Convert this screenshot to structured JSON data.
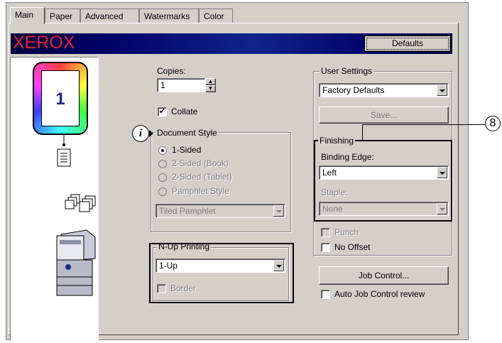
{
  "tabs": [
    "Main",
    "Paper",
    "Advanced",
    "Watermarks",
    "Color"
  ],
  "banner": {
    "brand": "XEROX",
    "defaults_label": "Defaults"
  },
  "preview": {
    "page_number": "1"
  },
  "copies": {
    "label": "Copies:",
    "value": "1"
  },
  "collate": {
    "label": "Collate",
    "checked": true
  },
  "document_style": {
    "label": "Document Style",
    "options": [
      "1-Sided",
      "2-Sided (Book)",
      "2-Sided (Tablet)",
      "Pamphlet Style"
    ],
    "selected": "1-Sided",
    "pamphlet_select": "Tiled Pamphlet"
  },
  "nup": {
    "label": "N-Up Printing",
    "value": "1-Up",
    "border_label": "Border"
  },
  "user_settings": {
    "label": "User Settings",
    "value": "Factory Defaults",
    "save_label": "Save..."
  },
  "finishing": {
    "label": "Finishing",
    "binding_label": "Binding Edge:",
    "binding_value": "Left",
    "staple_label": "Staple:",
    "staple_value": "None",
    "punch_label": "Punch",
    "no_offset_label": "No Offset"
  },
  "job_control": {
    "button_label": "Job Control...",
    "review_label": "Auto Job Control review"
  },
  "callout": "8",
  "colors": {
    "dialog_bg": "#d4d0c8",
    "brand_red": "#e32129",
    "banner_blue": "#000066",
    "page_number_blue": "#1a2a8c"
  }
}
